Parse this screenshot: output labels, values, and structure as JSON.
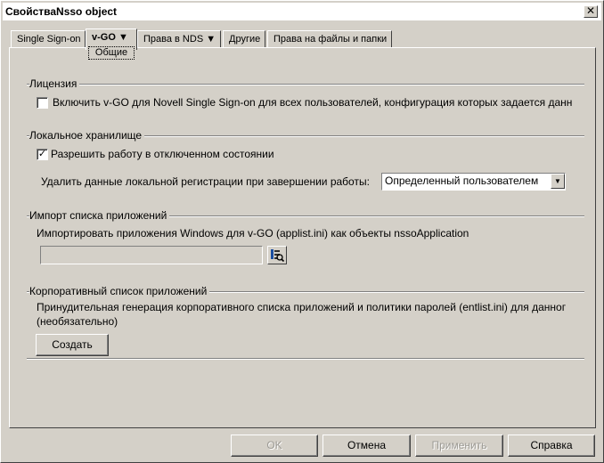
{
  "window": {
    "title": "СвойстваNsso object",
    "close_glyph": "✕"
  },
  "tabs": [
    {
      "label": "Single Sign-on"
    },
    {
      "label": "v-GO ▼"
    },
    {
      "label": "Права в NDS ▼"
    },
    {
      "label": "Другие"
    },
    {
      "label": "Права на файлы и папки"
    }
  ],
  "subtab": {
    "label": "Общие"
  },
  "license": {
    "legend": "Лицензия",
    "checkbox_label": "Включить v-GO для Novell Single Sign-on для всех пользователей, конфигурация которых задается данн",
    "checked": false
  },
  "local_storage": {
    "legend": "Локальное хранилище",
    "checkbox_label": "Разрешить работу в отключенном состоянии",
    "checked": true,
    "delete_label": "Удалить данные локальной регистрации при завершении работы:",
    "delete_selected": "Определенный пользователем"
  },
  "import": {
    "legend": "Импорт списка приложений",
    "description": "Импортировать приложения Windows для v-GO (applist.ini) как объекты nssoApplication",
    "path_value": ""
  },
  "corporate": {
    "legend": "Корпоративный список приложений",
    "line1": "Принудительная генерация корпоративного списка приложений и политики паролей (entlist.ini) для данног",
    "line2": "(необязательно)",
    "create_label": "Создать"
  },
  "buttons": {
    "ok": "OK",
    "cancel": "Отмена",
    "apply": "Применить",
    "help": "Справка"
  },
  "icons": {
    "close": "close-icon",
    "dropdown": "chevron-down-icon",
    "browse": "browse-folder-icon",
    "check": "checkmark-icon"
  }
}
